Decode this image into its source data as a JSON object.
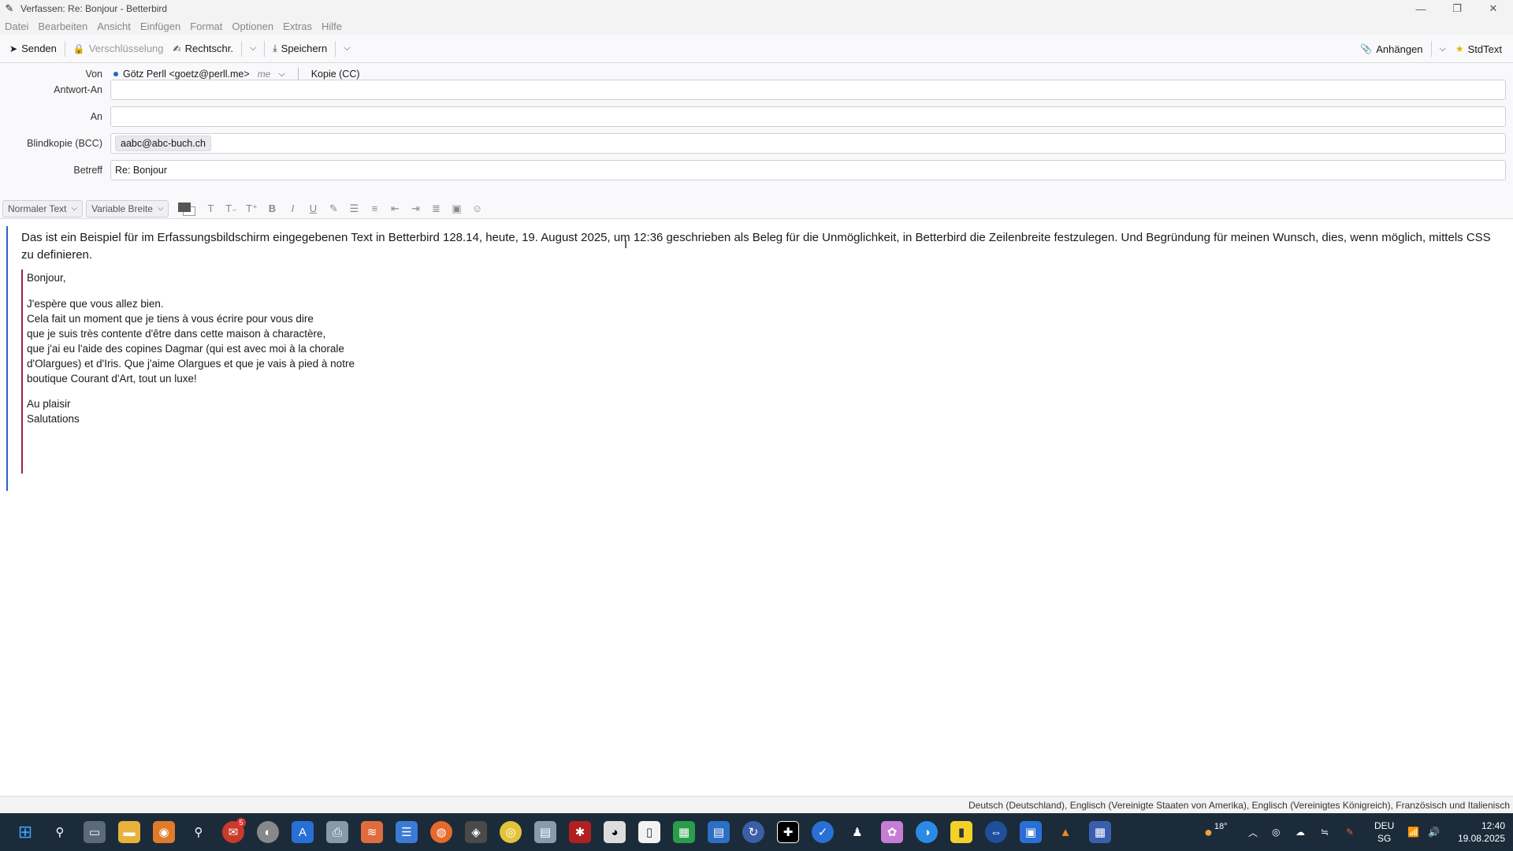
{
  "window": {
    "title": "Verfassen: Re: Bonjour - Betterbird",
    "controls": [
      "—",
      "❐",
      "✕"
    ]
  },
  "menu": [
    "Datei",
    "Bearbeiten",
    "Ansicht",
    "Einfügen",
    "Format",
    "Optionen",
    "Extras",
    "Hilfe"
  ],
  "toolbar": {
    "send": "Senden",
    "encryption": "Verschlüsselung",
    "spelling": "Rechtschr.",
    "save": "Speichern",
    "attach": "Anhängen",
    "stdtext": "StdText"
  },
  "headers": {
    "from_label": "Von",
    "from_value": "Götz Perll <goetz@perll.me>",
    "from_identity": "me",
    "cc_link": "Kopie (CC)",
    "reply_to_label": "Antwort-An",
    "reply_to_value": "",
    "to_label": "An",
    "to_value": "",
    "bcc_label": "Blindkopie (BCC)",
    "bcc_pill": "aabc@abc-buch.ch",
    "subject_label": "Betreff",
    "subject_value": "Re: Bonjour"
  },
  "format": {
    "paragraph_style": "Normaler Text",
    "font": "Variable Breite"
  },
  "body": {
    "intro": "Das ist ein Beispiel für im Erfassungsbildschirm eingegebenen Text in Betterbird 128.14, heute, 19. August 2025, um 12:36 geschrieben als Beleg für die Unmöglichkeit, in Betterbird die Zeilenbreite festzulegen. Und Begründung für meinen Wunsch, dies, wenn möglich, mittels CSS zu definieren.",
    "quote": {
      "greeting": "Bonjour,",
      "lines": [
        "J'espère que vous allez bien.",
        "Cela fait un moment que je tiens à vous écrire pour vous dire",
        "que je suis très contente d'être dans cette maison à charactère,",
        "que j'ai eu l'aide des copines Dagmar (qui est avec moi à la chorale",
        "d'Olargues) et d'Iris. Que j'aime Olargues et que je vais à pied à notre",
        "boutique Courant d'Art, tout un luxe!"
      ],
      "closing1": "Au plaisir",
      "closing2": "Salutations"
    }
  },
  "status": {
    "languages": "Deutsch (Deutschland), Englisch (Vereinigte Staaten von Amerika), Englisch (Vereinigtes Königreich), Französisch und Italienisch"
  },
  "taskbar": {
    "weather": "18°",
    "lang_top": "DEU",
    "lang_bottom": "SG",
    "time": "12:40",
    "date": "19.08.2025",
    "badge": "5"
  }
}
